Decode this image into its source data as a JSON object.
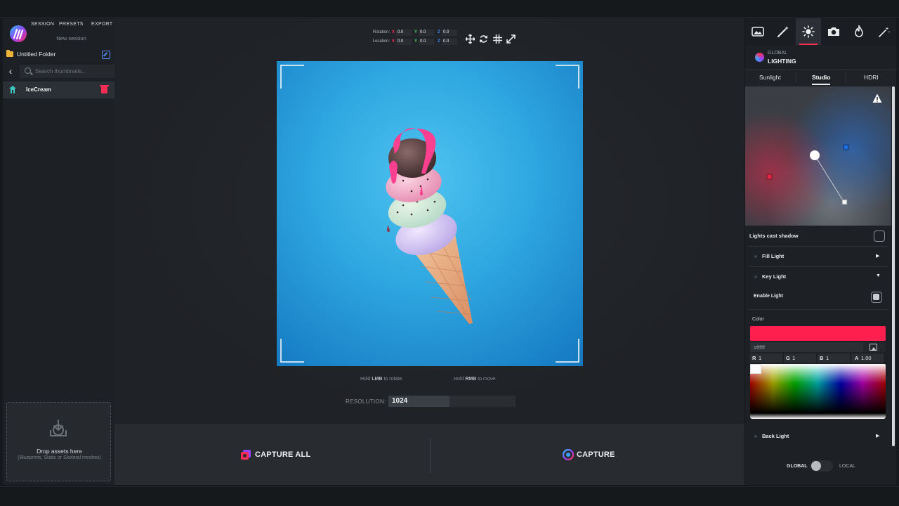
{
  "menu": {
    "session": "SESSION",
    "presets": "PRESETS",
    "export": "EXPORT",
    "session_name": "New session"
  },
  "left": {
    "folder_name": "Untitled Folder",
    "search_placeholder": "Search thumbnails...",
    "assets": [
      {
        "name": "IceCream"
      }
    ],
    "drop_title": "Drop assets here",
    "drop_subtitle": "(Blueprints, Static or Skeletal meshes)"
  },
  "transform": {
    "rotation_label": "Rotation:",
    "location_label": "Location:",
    "axis_x": "X",
    "axis_y": "Y",
    "axis_z": "Z",
    "rotation": {
      "x": "0.0",
      "y": "0.0",
      "z": "0.0"
    },
    "location": {
      "x": "0.0",
      "y": "0.0",
      "z": "0.0"
    }
  },
  "hints": {
    "rotate_prefix": "Hold ",
    "rotate_key": "LMB",
    "rotate_suffix": " to rotate.",
    "move_prefix": "Hold ",
    "move_key": "RMB",
    "move_suffix": " to move."
  },
  "resolution": {
    "label": "RESOLUTION:",
    "value": "1024",
    "fill_fraction": 0.48
  },
  "capture": {
    "capture_all": "CAPTURE ALL",
    "capture": "CAPTURE"
  },
  "right": {
    "tabs": [
      "image-icon",
      "magic-wand-icon",
      "sun-icon",
      "camera-icon",
      "flame-icon",
      "sparkle-wand-icon"
    ],
    "active_tab": 2,
    "global_small": "GLOBAL",
    "global_big": "LIGHTING",
    "subtabs": [
      "Sunlight",
      "Studio",
      "HDRI"
    ],
    "active_subtab": 1,
    "lights_cast_shadow": "Lights cast shadow",
    "fill_light": "Fill Light",
    "key_light": "Key Light",
    "enable_light": "Enable Light",
    "color_label": "Color",
    "hex_value": "#ffffff",
    "r_label": "R",
    "r_value": "1",
    "g_label": "G",
    "g_value": "1",
    "b_label": "B",
    "b_value": "1",
    "a_label": "A",
    "a_value": "1.00",
    "back_light": "Back Light",
    "toggle_global": "GLOBAL",
    "toggle_local": "LOCAL"
  },
  "colors": {
    "accent": "#ff2d55",
    "key_light_color": "#ff1f4f",
    "fill_light_marker": "#e62548",
    "back_light_marker": "#1c6fe0",
    "viewport_bg": "#2ea6e0",
    "folder_icon": "#f0b33a",
    "edit_icon": "#5b8cff"
  }
}
